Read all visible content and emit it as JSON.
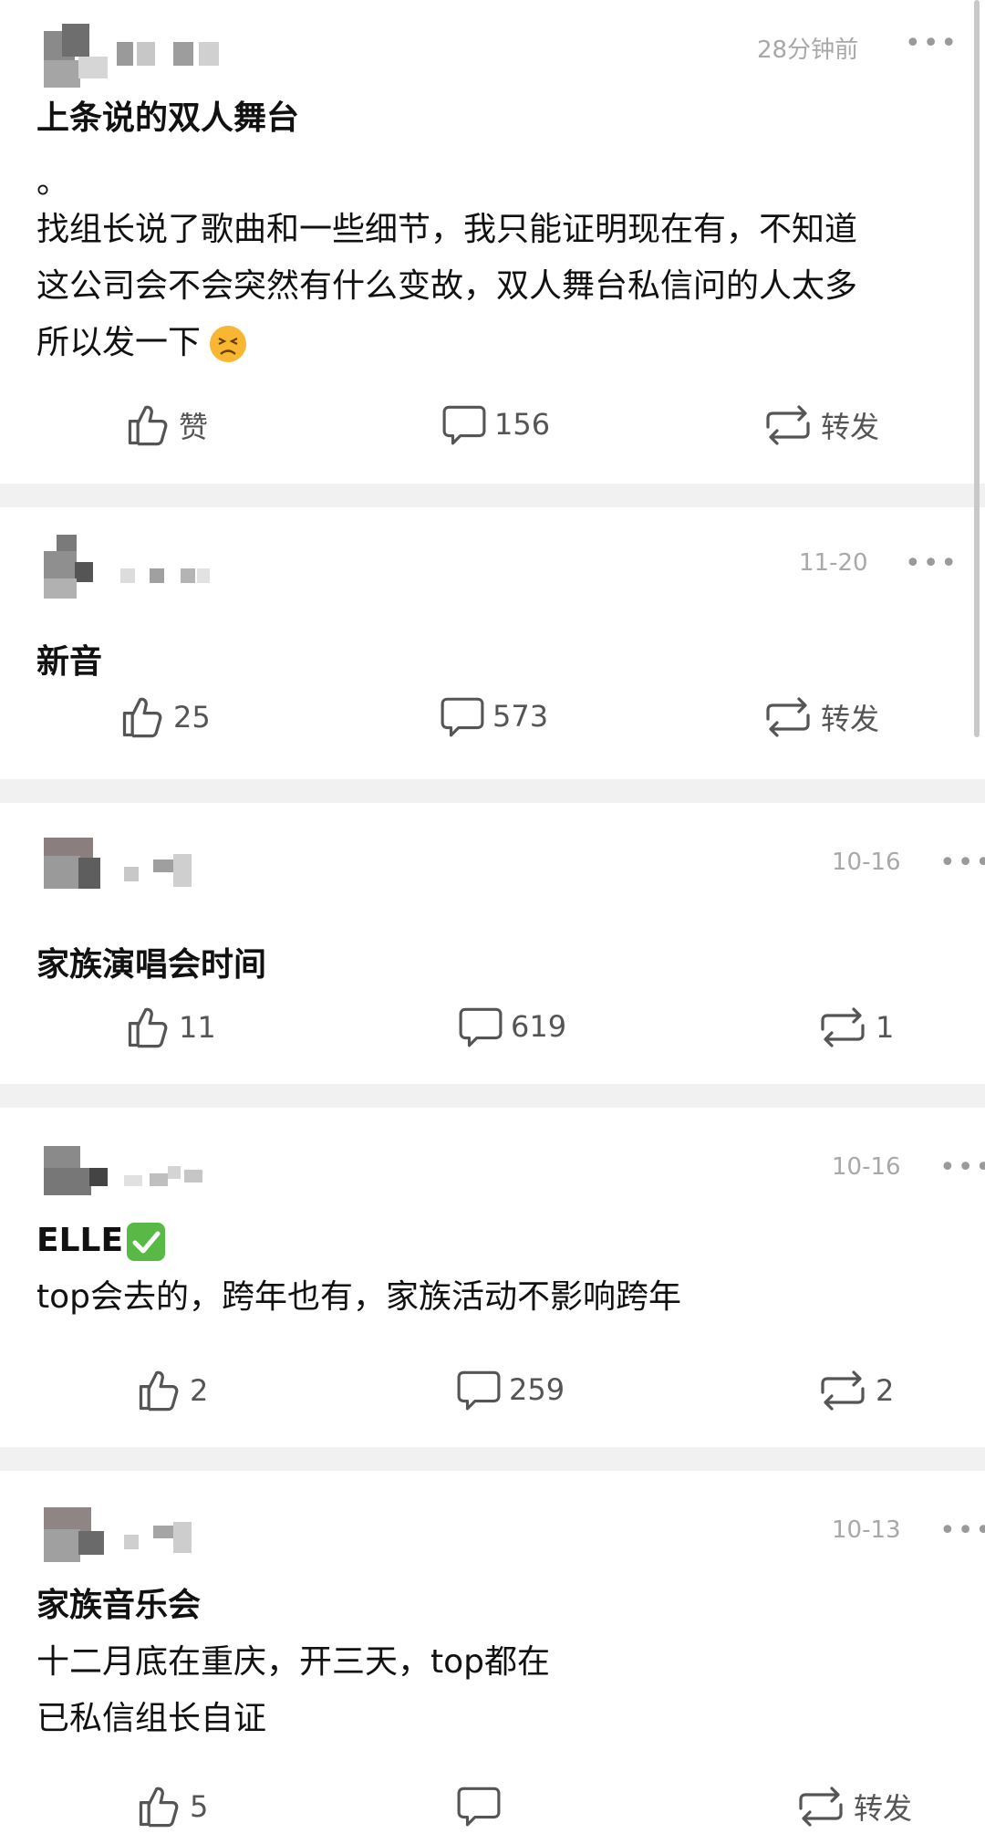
{
  "posts": [
    {
      "time": "28分钟前",
      "more": "•••",
      "lines": [
        "上条说的双人舞台",
        "。",
        "找组长说了歌曲和一些细节，我只能证明现在有，不知道",
        "这公司会不会突然有什么变故，双人舞台私信问的人太多",
        "所以发一下"
      ],
      "emoji": "persevering-face",
      "like": "赞",
      "comment": "156",
      "repost": "转发"
    },
    {
      "time": "11-20",
      "more": "•••",
      "lines": [
        "新音"
      ],
      "like": "25",
      "comment": "573",
      "repost": "转发"
    },
    {
      "time": "10-16",
      "more": "•••",
      "lines": [
        "家族演唱会时间"
      ],
      "like": "11",
      "comment": "619",
      "repost": "1"
    },
    {
      "time": "10-16",
      "more": "•••",
      "lines": [
        "ELLE",
        "top会去的，跨年也有，家族活动不影响跨年"
      ],
      "emoji": "check-mark-button",
      "like": "2",
      "comment": "259",
      "repost": "2"
    },
    {
      "time": "10-13",
      "more": "•••",
      "lines": [
        "家族音乐会",
        "十二月底在重庆，开三天，top都在",
        "已私信组长自证"
      ],
      "like": "5",
      "comment": "",
      "repost": "转发"
    }
  ],
  "colors": {
    "text": "#111111",
    "meta": "#a8a8a8",
    "action": "#555555",
    "divider": "#f1f1f1"
  }
}
